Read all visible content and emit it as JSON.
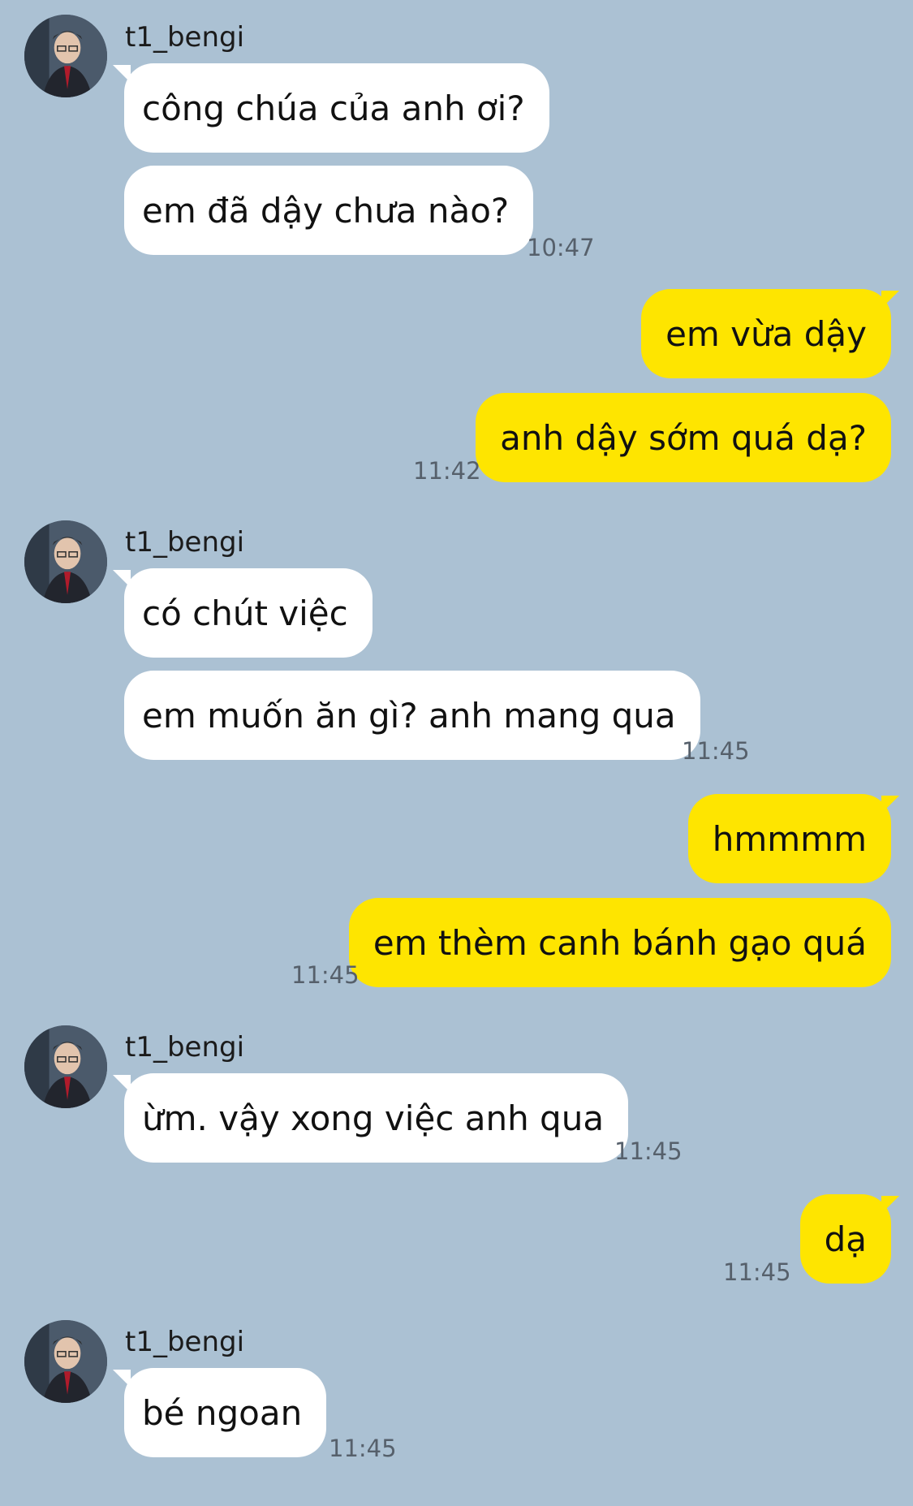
{
  "messages": [
    {
      "sender": "t1_bengi"
    },
    {
      "text": "công chúa của anh ơi?"
    },
    {
      "text": "em đã dậy chưa nào?",
      "time": "10:47"
    },
    {
      "text": "em vừa dậy"
    },
    {
      "text": "anh dậy sớm quá dạ?",
      "time": "11:42"
    },
    {
      "sender": "t1_bengi"
    },
    {
      "text": "có chút việc"
    },
    {
      "text": "em muốn ăn gì? anh mang qua",
      "time": "11:45"
    },
    {
      "text": "hmmmm"
    },
    {
      "text": "em thèm canh bánh gạo quá",
      "time": "11:45"
    },
    {
      "sender": "t1_bengi"
    },
    {
      "text": "ừm. vậy xong việc anh qua",
      "time": "11:45"
    },
    {
      "text": "dạ",
      "time": "11:45"
    },
    {
      "sender": "t1_bengi"
    },
    {
      "text": "bé ngoan",
      "time": "11:45"
    }
  ],
  "colors": {
    "background": "#abc1d3",
    "incoming_bubble": "#ffffff",
    "outgoing_bubble": "#fee500"
  },
  "icons": {
    "avatar": "avatar-icon"
  }
}
